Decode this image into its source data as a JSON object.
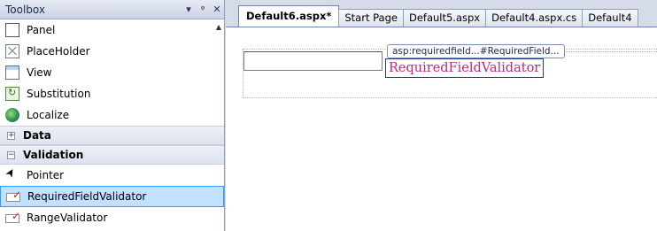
{
  "toolbox": {
    "title": "Toolbox",
    "ctrl_dropdown": "▾",
    "ctrl_pin": "ᵠ",
    "ctrl_close": "✕",
    "items": [
      {
        "label": "Panel",
        "icon": "panel-icon"
      },
      {
        "label": "PlaceHolder",
        "icon": "placeholder-icon"
      },
      {
        "label": "View",
        "icon": "view-icon"
      },
      {
        "label": "Substitution",
        "icon": "substitution-icon"
      },
      {
        "label": "Localize",
        "icon": "localize-globe-icon"
      }
    ],
    "groups": {
      "data": {
        "label": "Data",
        "expander": "+"
      },
      "validation": {
        "label": "Validation",
        "expander": "−"
      }
    },
    "validation_items": [
      {
        "label": "Pointer",
        "icon": "pointer-icon"
      },
      {
        "label": "RequiredFieldValidator",
        "icon": "required-field-validator-icon",
        "selected": true
      },
      {
        "label": "RangeValidator",
        "icon": "range-validator-icon"
      }
    ]
  },
  "editor": {
    "tabs": [
      {
        "label": "Default6.aspx*",
        "active": true
      },
      {
        "label": "Start Page"
      },
      {
        "label": "Default5.aspx"
      },
      {
        "label": "Default4.aspx.cs"
      },
      {
        "label": "Default4"
      }
    ],
    "control_tag": "asp:requiredfield...#RequiredField...",
    "validator_text": "RequiredFieldValidator",
    "textbox_value": ""
  },
  "colors": {
    "selection_bg": "#c2e0ff",
    "selection_border": "#3399ff",
    "validator_text": "#c0287c",
    "chrome_bg": "#d6dbe9"
  }
}
